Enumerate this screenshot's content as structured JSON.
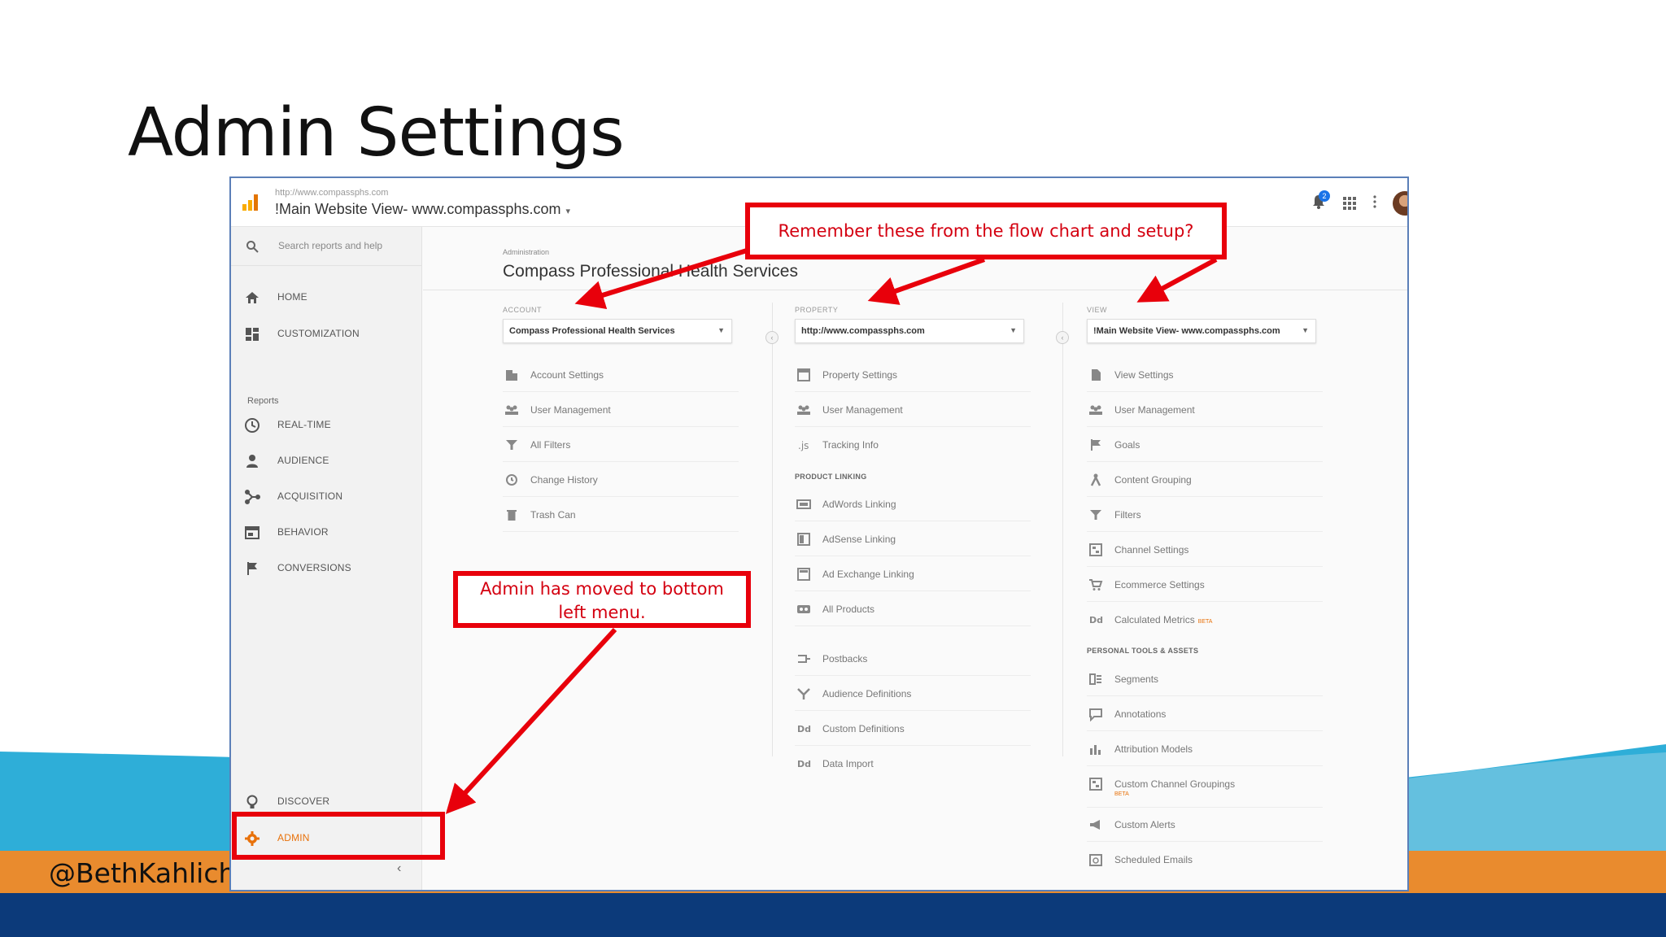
{
  "slide": {
    "title": "Admin Settings",
    "handle": "@BethKahlich",
    "colors": {
      "blue_band": "#0c3a7a",
      "teal_wave": "#2eaed8",
      "orange_band": "#e98b2e",
      "callout_red": "#e8000b"
    }
  },
  "app": {
    "topbar": {
      "url": "http://www.compassphs.com",
      "view_name": "!Main Website View- www.compassphs.com",
      "caret": "▾",
      "notification_count": "2",
      "icons": [
        "analytics-logo-icon",
        "bell-icon",
        "apps-grid-icon",
        "kebab-menu-icon",
        "avatar"
      ]
    },
    "leftnav": {
      "search_placeholder": "Search reports and help",
      "items_top": [
        {
          "label": "HOME",
          "icon": "home-icon"
        },
        {
          "label": "CUSTOMIZATION",
          "icon": "dashboard-icon"
        }
      ],
      "reports_heading": "Reports",
      "report_items": [
        {
          "label": "REAL-TIME",
          "icon": "clock-icon"
        },
        {
          "label": "AUDIENCE",
          "icon": "person-icon"
        },
        {
          "label": "ACQUISITION",
          "icon": "acquisition-icon"
        },
        {
          "label": "BEHAVIOR",
          "icon": "behavior-icon"
        },
        {
          "label": "CONVERSIONS",
          "icon": "flag-icon"
        }
      ],
      "bottom_items": [
        {
          "label": "DISCOVER",
          "icon": "lightbulb-icon"
        },
        {
          "label": "ADMIN",
          "icon": "gear-icon"
        }
      ],
      "collapse": "‹"
    },
    "main": {
      "breadcrumb": "Administration",
      "account_title": "Compass Professional Health Services",
      "columns": {
        "account": {
          "label": "ACCOUNT",
          "selected": "Compass Professional Health Services",
          "items": [
            "Account Settings",
            "User Management",
            "All Filters",
            "Change History",
            "Trash Can"
          ]
        },
        "property": {
          "label": "PROPERTY",
          "selected": "http://www.compassphs.com",
          "items": [
            "Property Settings",
            "User Management",
            "Tracking Info"
          ],
          "product_linking_heading": "PRODUCT LINKING",
          "linking_items": [
            "AdWords Linking",
            "AdSense Linking",
            "Ad Exchange Linking",
            "All Products"
          ],
          "other_items": [
            "Postbacks",
            "Audience Definitions",
            "Custom Definitions",
            "Data Import"
          ]
        },
        "view": {
          "label": "VIEW",
          "selected": "!Main Website View- www.compassphs.com",
          "items": [
            "View Settings",
            "User Management",
            "Goals",
            "Content Grouping",
            "Filters",
            "Channel Settings",
            "Ecommerce Settings",
            "Calculated Metrics"
          ],
          "calculated_metrics_badge": "BETA",
          "personal_heading": "PERSONAL TOOLS & ASSETS",
          "personal_items": [
            "Segments",
            "Annotations",
            "Attribution Models",
            "Custom Channel Groupings",
            "Custom Alerts",
            "Scheduled Emails"
          ],
          "custom_channel_badge": "BETA"
        }
      }
    }
  },
  "callouts": {
    "top": "Remember these from the flow chart and setup?",
    "admin_line1": "Admin has moved to bottom",
    "admin_line2": "left menu."
  }
}
